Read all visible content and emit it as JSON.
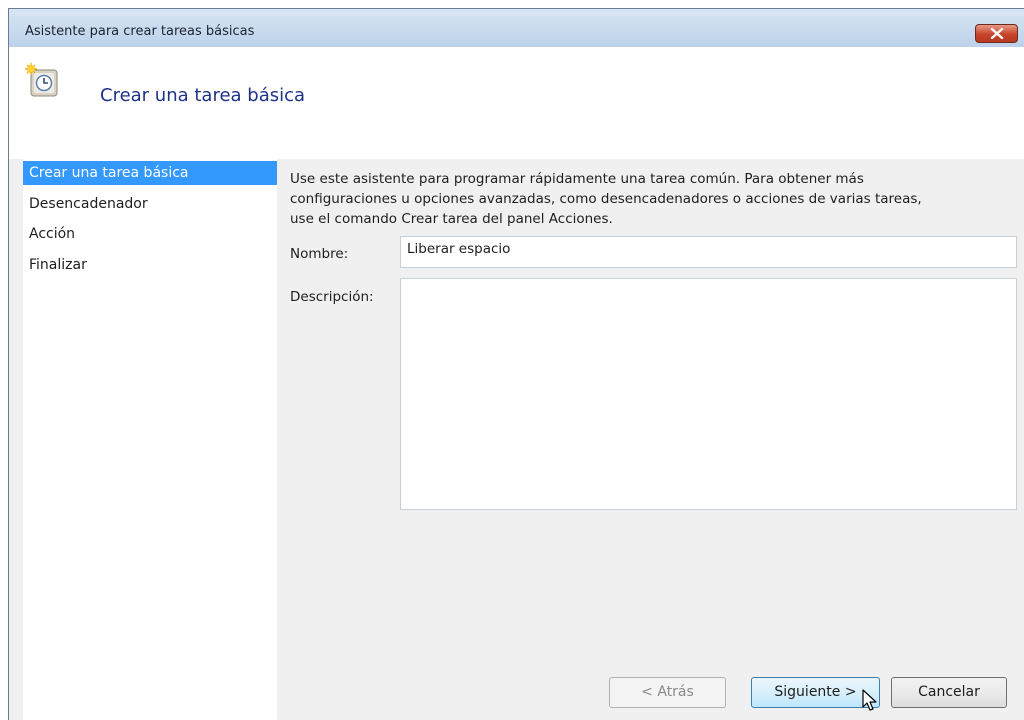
{
  "window": {
    "title": "Asistente para crear tareas básicas",
    "close_icon": "close-icon"
  },
  "header": {
    "icon": "scheduled-task-icon",
    "title": "Crear una tarea básica"
  },
  "steps": [
    {
      "label": "Crear una tarea básica",
      "active": true
    },
    {
      "label": "Desencadenador",
      "active": false
    },
    {
      "label": "Acción",
      "active": false
    },
    {
      "label": "Finalizar",
      "active": false
    }
  ],
  "intro": {
    "line1": "Use este asistente para programar rápidamente una tarea común. Para obtener más",
    "line2": "configuraciones u opciones avanzadas, como desencadenadores o acciones de varias tareas,",
    "line3": "use el comando Crear tarea del panel Acciones."
  },
  "form": {
    "name_label": "Nombre:",
    "name_value": "Liberar espacio",
    "description_label": "Descripción:",
    "description_value": ""
  },
  "buttons": {
    "back": "< Atrás",
    "next": "Siguiente >",
    "cancel": "Cancelar"
  },
  "colors": {
    "selected_step": "#3399ff",
    "header_title": "#1e3287",
    "close_button": "#c7452b"
  }
}
